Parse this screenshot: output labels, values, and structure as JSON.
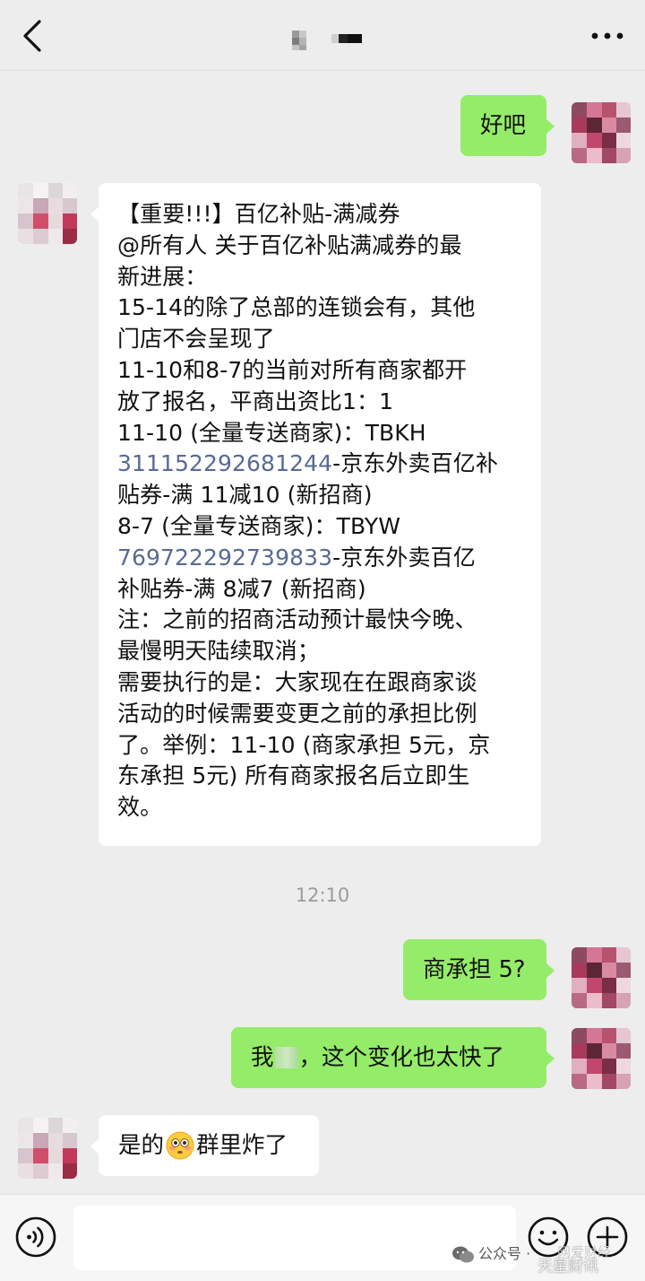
{
  "header": {
    "back_icon": "chevron-left-icon",
    "more_icon": "more-dots-icon",
    "title_pixelated": true
  },
  "messages": [
    {
      "side": "right",
      "text": "好吧"
    },
    {
      "side": "left",
      "lines": [
        "【重要!!!】百亿补贴-满减券",
        "@所有人 关于百亿补贴满减券的最",
        "新进展：",
        "15-14的除了总部的连锁会有，其他",
        "门店不会呈现了",
        "11-10和8-7的当前对所有商家都开",
        "放了报名，平商出资比1：1",
        "11-10 (全量专送商家)：TBKH",
        "311152292681244",
        "-京东外卖百亿补",
        "贴券-满 11减10 (新招商)",
        "8-7 (全量专送商家)：TBYW",
        "769722292739833",
        "-京东外卖百亿",
        "补贴券-满 8减7 (新招商)",
        "注：之前的招商活动预计最快今晚、",
        "最慢明天陆续取消；",
        "需要执行的是：大家现在在跟商家谈",
        "活动的时候需要变更之前的承担比例",
        "了。举例：11-10 (商家承担 5元，京",
        "东承担 5元) 所有商家报名后立即生",
        "效。"
      ]
    },
    {
      "timestamp": "12:10"
    },
    {
      "side": "right",
      "text": "商承担 5?"
    },
    {
      "side": "right",
      "text_before": "我",
      "text_after": "，这个变化也太快了"
    },
    {
      "side": "left",
      "text_before": "是的",
      "emoji": "flushed-face-icon",
      "text_after": "群里炸了"
    }
  ],
  "input_bar": {
    "voice_icon": "voice-icon",
    "emoji_icon": "emoji-smile-icon",
    "plus_icon": "plus-circle-icon",
    "text_value": ""
  },
  "watermark": {
    "source": "公众号 · ",
    "account": "网爱财经",
    "weibo": "天星财讯"
  },
  "colors": {
    "background": "#ededed",
    "my_bubble": "#95ec69",
    "other_bubble": "#ffffff",
    "link": "#576b95",
    "timestamp": "#9b9b9b"
  }
}
